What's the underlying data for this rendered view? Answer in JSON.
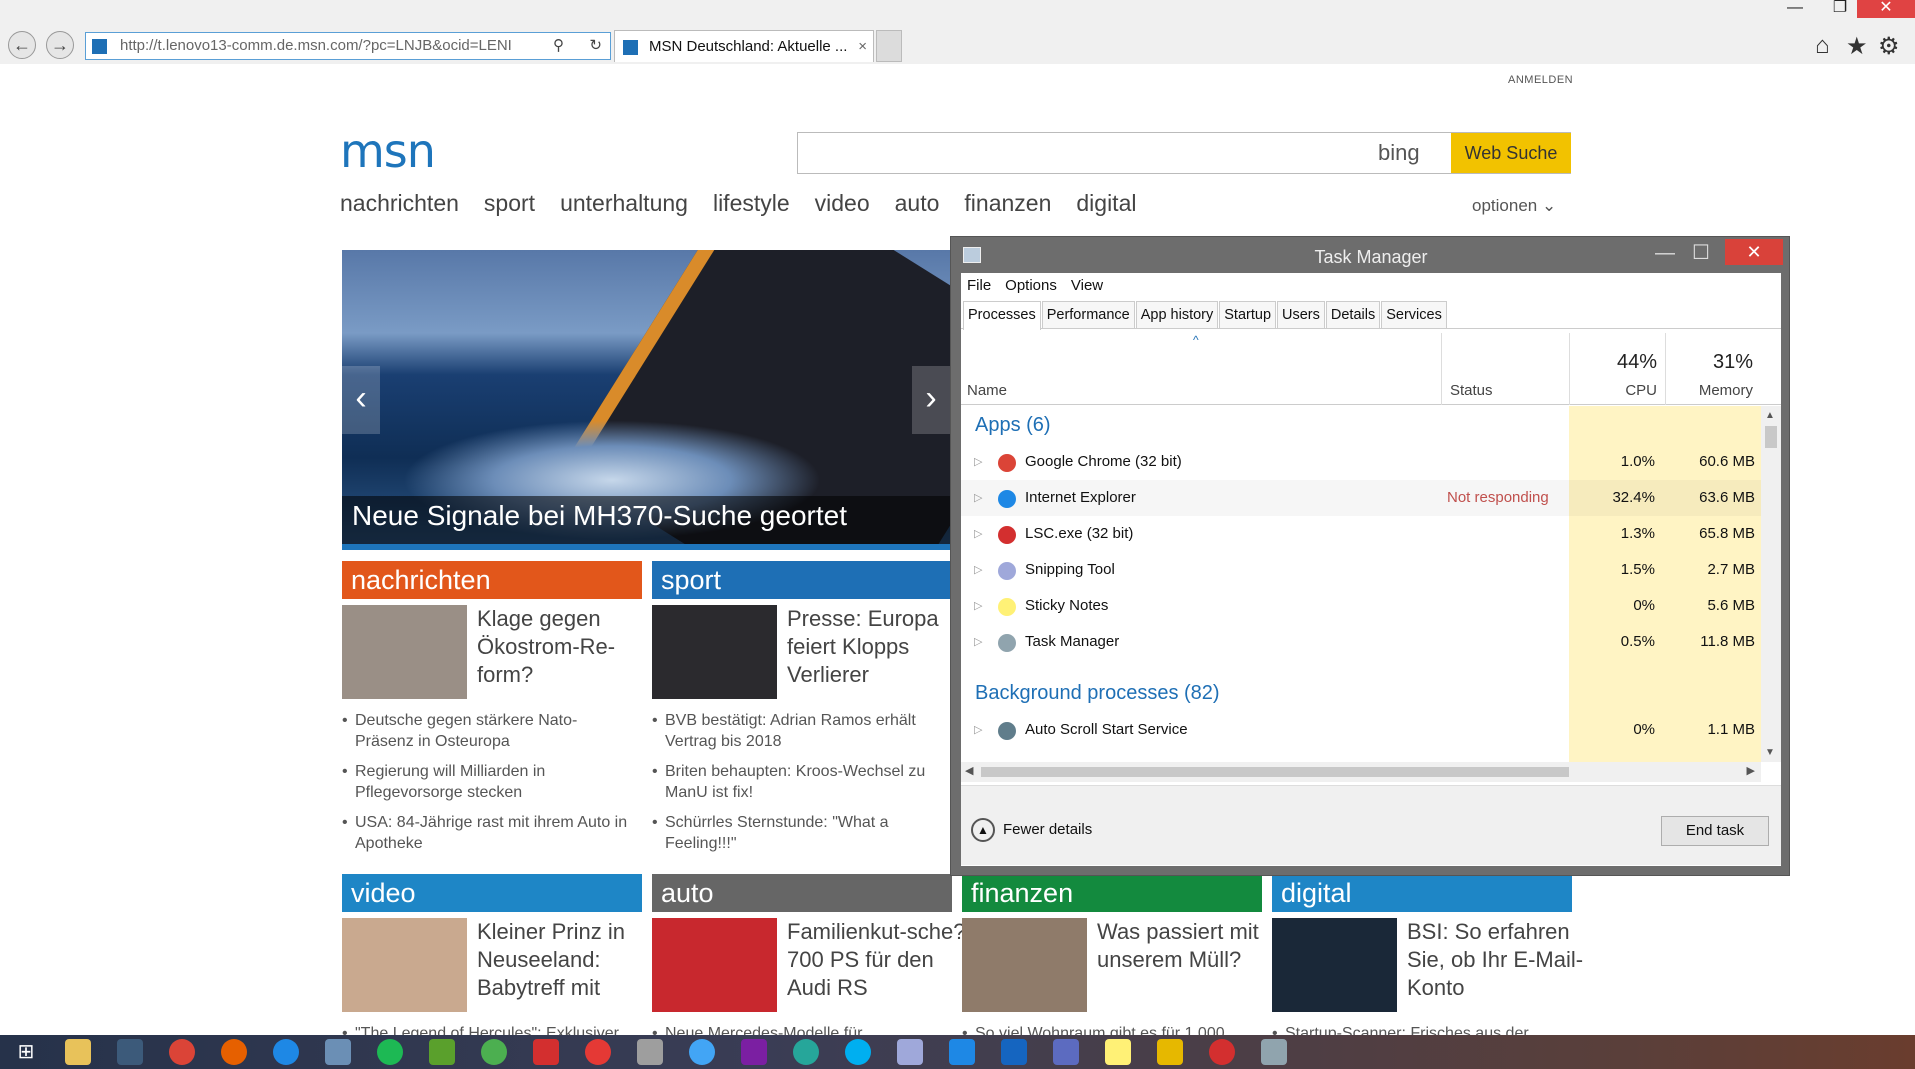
{
  "browser": {
    "url": "http://t.lenovo13-comm.de.msn.com/?pc=LNJB&ocid=LENI",
    "tab_title": "MSN Deutschland: Aktuelle ...",
    "tab_close": "×",
    "back": "←",
    "forward": "→"
  },
  "window": {
    "minimize": "—",
    "restore": "❐",
    "close": "✕"
  },
  "msn": {
    "login": "ANMELDEN",
    "logo": "msn",
    "bing": "bing",
    "search_button": "Web Suche",
    "nav": [
      "nachrichten",
      "sport",
      "unterhaltung",
      "lifestyle",
      "video",
      "auto",
      "finanzen",
      "digital"
    ],
    "options": "optionen ⌄",
    "hero": {
      "caption": "Neue Signale bei MH370-Suche geortet",
      "prev": "‹",
      "next": "›"
    },
    "sections": [
      {
        "name": "nachrichten",
        "color": "#e2571b",
        "title": "Klage gegen Ökostrom-Re-form?",
        "bullets": [
          "Deutsche gegen stärkere Nato-Präsenz in Osteuropa",
          "Regierung will Milliarden in Pflegevorsorge stecken",
          "USA: 84-Jährige rast mit ihrem Auto in Apotheke"
        ]
      },
      {
        "name": "sport",
        "color": "#1e6fb5",
        "title": "Presse: Europa feiert Klopps Verlierer",
        "bullets": [
          "BVB bestätigt: Adrian Ramos erhält Vertrag bis 2018",
          "Briten behaupten: Kroos-Wechsel zu ManU ist fix!",
          "Schürrles Sternstunde: \"What a Feeling!!!\""
        ]
      },
      {
        "name": "video",
        "color": "#1e86c6",
        "title": "Kleiner Prinz in Neuseeland: Babytreff mit",
        "bullets": [
          "\"The Legend of Hercules\": Exklusiver"
        ]
      },
      {
        "name": "auto",
        "color": "#666666",
        "title": "Familienkut-sche? 700 PS für den Audi RS",
        "bullets": [
          "Neue Mercedes-Modelle für"
        ]
      },
      {
        "name": "finanzen",
        "color": "#138a3e",
        "title": "Was passiert mit unserem Müll?",
        "bullets": [
          "So viel Wohnraum gibt es für 1.000"
        ]
      },
      {
        "name": "digital",
        "color": "#1e86c6",
        "title": "BSI: So erfahren Sie, ob Ihr E-Mail-Konto",
        "bullets": [
          "Startup-Scanner: Frisches aus der"
        ]
      }
    ]
  },
  "taskmanager": {
    "title": "Task Manager",
    "close": "✕",
    "minimize": "—",
    "maximize": "☐",
    "menu": [
      "File",
      "Options",
      "View"
    ],
    "tabs": [
      "Processes",
      "Performance",
      "App history",
      "Startup",
      "Users",
      "Details",
      "Services"
    ],
    "columns": {
      "name": "Name",
      "status": "Status",
      "cpu_pct": "44%",
      "cpu": "CPU",
      "mem_pct": "31%",
      "memory": "Memory"
    },
    "sort_arrow": "^",
    "apps_label": "Apps (6)",
    "bg_label": "Background processes (82)",
    "apps": [
      {
        "name": "Google Chrome (32 bit)",
        "status": "",
        "cpu": "1.0%",
        "mem": "60.6 MB",
        "icon": "#db4437"
      },
      {
        "name": "Internet Explorer",
        "status": "Not responding",
        "cpu": "32.4%",
        "mem": "63.6 MB",
        "icon": "#1e88e5"
      },
      {
        "name": "LSC.exe (32 bit)",
        "status": "",
        "cpu": "1.3%",
        "mem": "65.8 MB",
        "icon": "#d32f2f"
      },
      {
        "name": "Snipping Tool",
        "status": "",
        "cpu": "1.5%",
        "mem": "2.7 MB",
        "icon": "#9fa8da"
      },
      {
        "name": "Sticky Notes",
        "status": "",
        "cpu": "0%",
        "mem": "5.6 MB",
        "icon": "#fff176"
      },
      {
        "name": "Task Manager",
        "status": "",
        "cpu": "0.5%",
        "mem": "11.8 MB",
        "icon": "#90a4ae"
      }
    ],
    "bg": [
      {
        "name": "Auto Scroll Start Service",
        "status": "",
        "cpu": "0%",
        "mem": "1.1 MB",
        "icon": "#607d8b"
      }
    ],
    "fewer": "Fewer details",
    "end_task": "End task"
  },
  "taskbar": {
    "start": "⊞"
  }
}
